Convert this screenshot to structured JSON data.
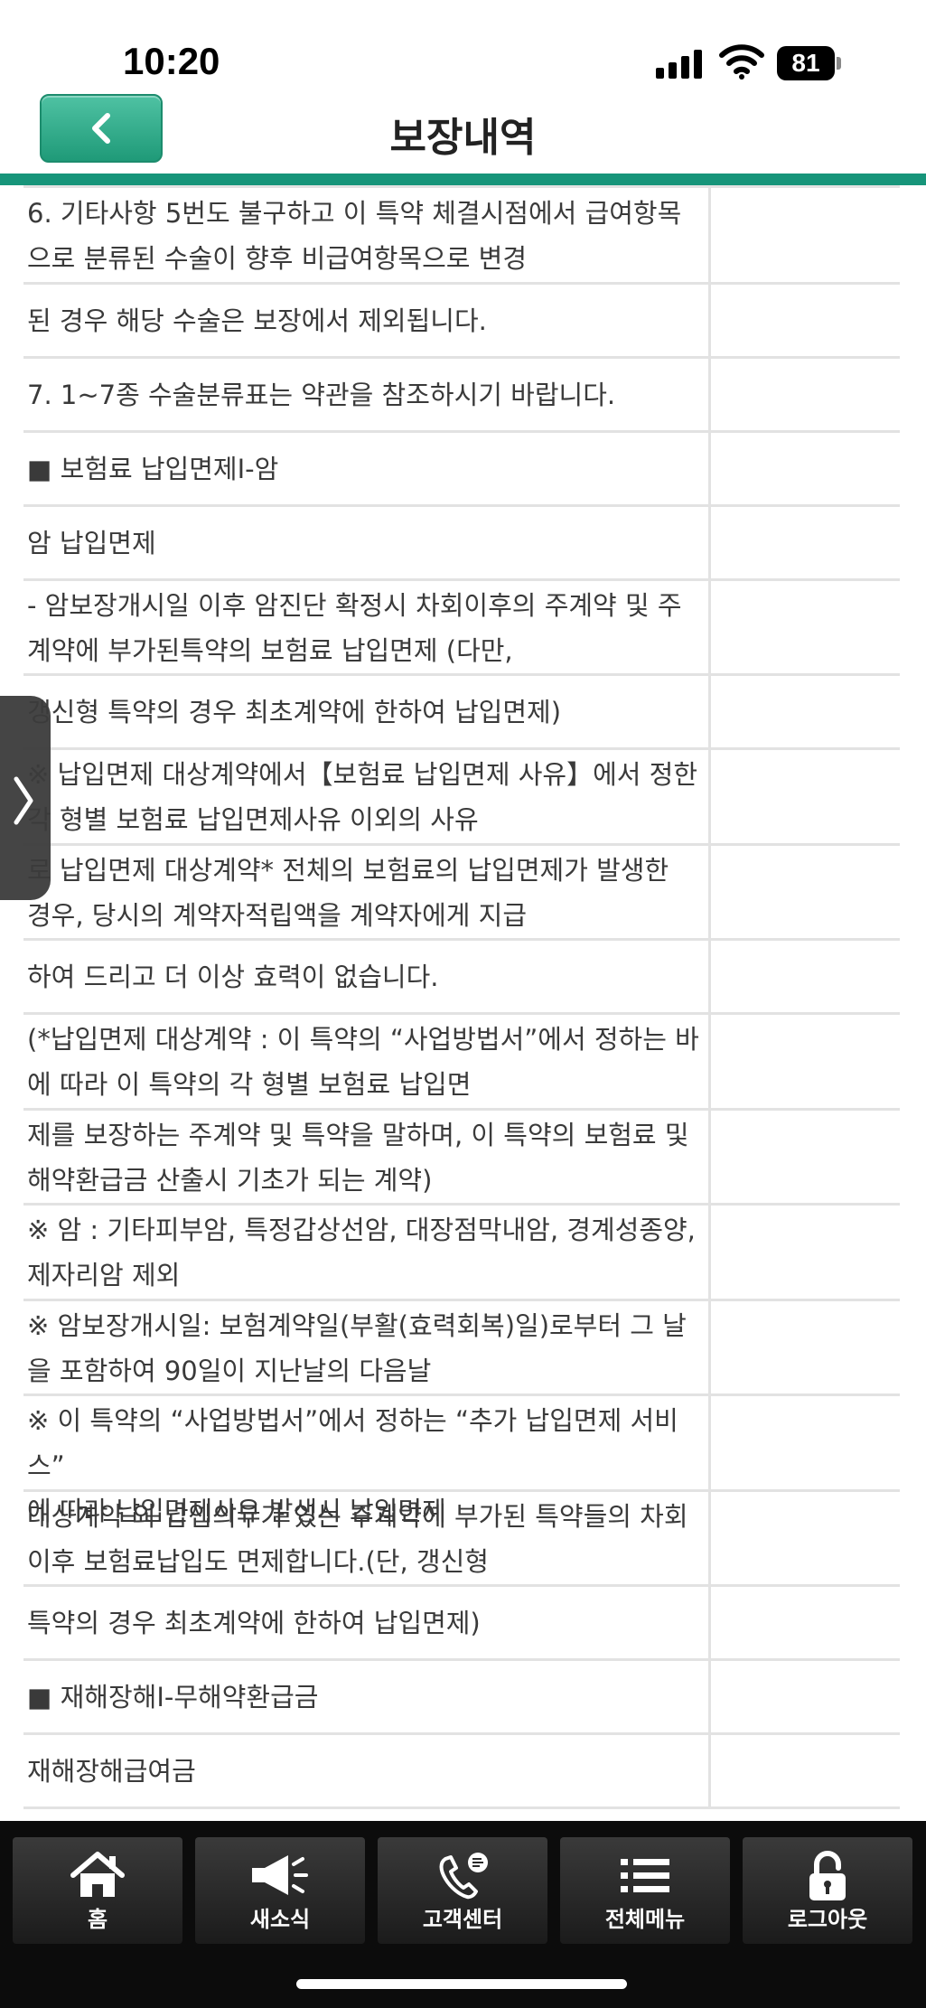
{
  "status_bar": {
    "time": "10:20",
    "battery": "81"
  },
  "header": {
    "title": "보장내역"
  },
  "rows": [
    {
      "text": "6. 기타사항 5번도 불구하고 이 특약 체결시점에서 급여항목\n으로 분류된 수술이 향후 비급여항목으로 변경"
    },
    {
      "text": "된 경우 해당 수술은 보장에서 제외됩니다."
    },
    {
      "text": "7. 1~7종 수술분류표는 약관을 참조하시기 바랍니다."
    },
    {
      "text": "■ 보험료 납입면제I-암"
    },
    {
      "text": "암 납입면제"
    },
    {
      "text": "- 암보장개시일 이후 암진단 확정시 차회이후의 주계약 및 주\n계약에 부가된특약의 보험료 납입면제 (다만,"
    },
    {
      "text": "갱신형 특약의 경우 최초계약에 한하여 납입면제)"
    },
    {
      "text": "※ 납입면제 대상계약에서【보험료 납입면제 사유】에서 정한\n각 형별 보험료 납입면제사유 이외의 사유"
    },
    {
      "text": "로 납입면제 대상계약* 전체의 보험료의 납입면제가 발생한\n경우, 당시의 계약자적립액을 계약자에게 지급"
    },
    {
      "text": "하여 드리고 더 이상 효력이 없습니다."
    },
    {
      "text": "(*납입면제 대상계약 : 이 특약의 “사업방법서”에서 정하는 바\n에 따라 이 특약의 각 형별 보험료 납입면"
    },
    {
      "text": "제를 보장하는 주계약 및 특약을 말하며, 이 특약의 보험료 및\n해약환급금 산출시 기초가 되는 계약)"
    },
    {
      "text": "※ 암 : 기타피부암, 특정갑상선암, 대장점막내암, 경계성종양,\n제자리암 제외"
    },
    {
      "text": "※ 암보장개시일: 보험계약일(부활(효력회복)일)로부터 그 날\n을 포함하여 90일이 지난날의 다음날"
    },
    {
      "text": "※ 이 특약의 “사업방법서”에서 정하는 “추가 납입면제 서비스”\n에 따라 납입면제사유 발생시 납입면제"
    },
    {
      "text": "대상계약 외 납입의무가 있는 주계약에 부가된 특약들의 차회\n이후 보험료납입도 면제합니다.(단, 갱신형"
    },
    {
      "text": "특약의 경우 최초계약에 한하여 납입면제)"
    },
    {
      "text": "■ 재해장해I-무해약환급금"
    },
    {
      "text": "재해장해급여금"
    }
  ],
  "tabs": [
    {
      "label": "홈",
      "icon": "home-icon"
    },
    {
      "label": "새소식",
      "icon": "megaphone-icon"
    },
    {
      "label": "고객센터",
      "icon": "phone-icon"
    },
    {
      "label": "전체메뉴",
      "icon": "menu-icon"
    },
    {
      "label": "로그아웃",
      "icon": "lock-icon"
    }
  ]
}
